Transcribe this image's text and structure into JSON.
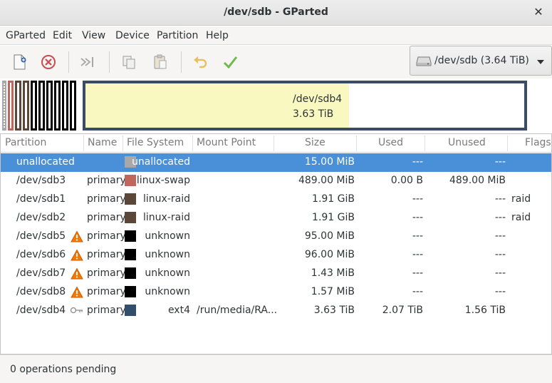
{
  "window": {
    "title": "/dev/sdb - GParted"
  },
  "menu": {
    "items": [
      "GParted",
      "Edit",
      "View",
      "Device",
      "Partition",
      "Help"
    ]
  },
  "toolbar": {
    "new_icon": "new-partition-icon",
    "delete_icon": "delete-icon",
    "resize_icon": "resize-move-icon",
    "copy_icon": "copy-icon",
    "paste_icon": "paste-icon",
    "undo_icon": "undo-icon",
    "apply_icon": "apply-checkmark-icon"
  },
  "device": {
    "label": "/dev/sdb (3.64 TiB)"
  },
  "graph": {
    "big_name": "/dev/sdb4",
    "big_size": "3.63 TiB",
    "big_used_fraction": 0.6
  },
  "columns": [
    "Partition",
    "Name",
    "File System",
    "Mount Point",
    "Size",
    "Used",
    "Unused",
    "Flags"
  ],
  "colors": {
    "unallocated": "#a8a8a8",
    "linux_swap": "#c1665a",
    "linux_raid": "#5b4637",
    "unknown": "#000000",
    "ext4": "#314e6c",
    "selection": "#4a90d9"
  },
  "rows": [
    {
      "partition": "unallocated",
      "name": "",
      "fs": "unallocated",
      "mount": "",
      "size": "15.00 MiB",
      "used": "---",
      "unused": "---",
      "flags": "",
      "color": "#a8a8a8",
      "badge": ""
    },
    {
      "partition": "/dev/sdb3",
      "name": "primary",
      "fs": "linux-swap",
      "mount": "",
      "size": "489.00 MiB",
      "used": "0.00 B",
      "unused": "489.00 MiB",
      "flags": "",
      "color": "#c1665a",
      "badge": ""
    },
    {
      "partition": "/dev/sdb1",
      "name": "primary",
      "fs": "linux-raid",
      "mount": "",
      "size": "1.91 GiB",
      "used": "---",
      "unused": "---",
      "flags": "raid",
      "color": "#5b4637",
      "badge": ""
    },
    {
      "partition": "/dev/sdb2",
      "name": "primary",
      "fs": "linux-raid",
      "mount": "",
      "size": "1.91 GiB",
      "used": "---",
      "unused": "---",
      "flags": "raid",
      "color": "#5b4637",
      "badge": ""
    },
    {
      "partition": "/dev/sdb5",
      "name": "primary",
      "fs": "unknown",
      "mount": "",
      "size": "95.00 MiB",
      "used": "---",
      "unused": "---",
      "flags": "",
      "color": "#000000",
      "badge": "warning-icon"
    },
    {
      "partition": "/dev/sdb6",
      "name": "primary",
      "fs": "unknown",
      "mount": "",
      "size": "96.00 MiB",
      "used": "---",
      "unused": "---",
      "flags": "",
      "color": "#000000",
      "badge": "warning-icon"
    },
    {
      "partition": "/dev/sdb7",
      "name": "primary",
      "fs": "unknown",
      "mount": "",
      "size": "1.43 MiB",
      "used": "---",
      "unused": "---",
      "flags": "",
      "color": "#000000",
      "badge": "warning-icon"
    },
    {
      "partition": "/dev/sdb8",
      "name": "primary",
      "fs": "unknown",
      "mount": "",
      "size": "1.57 MiB",
      "used": "---",
      "unused": "---",
      "flags": "",
      "color": "#000000",
      "badge": "warning-icon"
    },
    {
      "partition": "/dev/sdb4",
      "name": "primary",
      "fs": "ext4",
      "mount": "/run/media/RA...",
      "size": "3.63 TiB",
      "used": "2.07 TiB",
      "unused": "1.56 TiB",
      "flags": "",
      "color": "#314e6c",
      "badge": "key-icon"
    }
  ],
  "status": {
    "text": "0 operations pending"
  }
}
